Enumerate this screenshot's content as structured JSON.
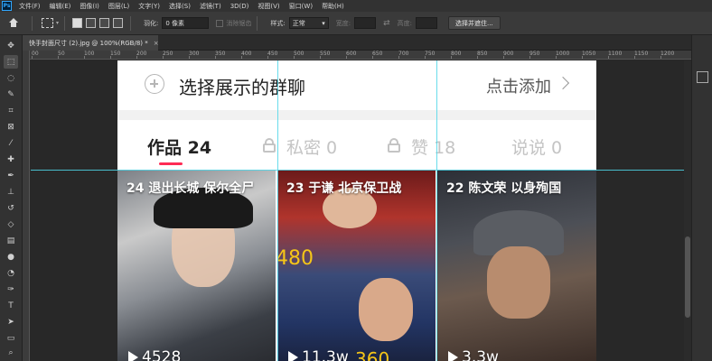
{
  "menubar": {
    "logo": "Ps",
    "items": [
      "文件(F)",
      "编辑(E)",
      "图像(I)",
      "图层(L)",
      "文字(Y)",
      "选择(S)",
      "滤镜(T)",
      "3D(D)",
      "视图(V)",
      "窗口(W)",
      "帮助(H)"
    ]
  },
  "options": {
    "feather_label": "羽化:",
    "feather_value": "0 像素",
    "antialias_label": "消除锯齿",
    "style_label": "样式:",
    "style_value": "正常",
    "width_label": "宽度:",
    "height_label": "高度:",
    "select_mask_button": "选择并遮住..."
  },
  "document": {
    "tab_title": "快手封面尺寸 (2).jpg @ 100%(RGB/8) *",
    "tab_close": "×"
  },
  "ruler": {
    "labels": [
      "00",
      "50",
      "100",
      "150",
      "200",
      "250",
      "300",
      "350",
      "400",
      "450",
      "500",
      "550",
      "600",
      "650",
      "700",
      "750",
      "800",
      "850",
      "900",
      "950",
      "1000",
      "1050",
      "1100",
      "1150",
      "1200"
    ]
  },
  "app": {
    "select_group": "选择展示的群聊",
    "click_add": "点击添加",
    "tabs": [
      {
        "label": "作品 24",
        "locked": false,
        "active": true
      },
      {
        "label": "私密 0",
        "locked": true,
        "active": false
      },
      {
        "label": "赞 18",
        "locked": true,
        "active": false
      },
      {
        "label": "说说 0",
        "locked": false,
        "active": false
      }
    ],
    "videos": [
      {
        "title": "24 退出长城 保尔全尸",
        "plays": "4528"
      },
      {
        "title": "23 于谦 北京保卫战",
        "plays": "11.3w",
        "overlay_left": "480",
        "overlay_bottom": "360"
      },
      {
        "title": "22 陈文荣 以身殉国",
        "plays": "3.3w"
      }
    ]
  },
  "colors": {
    "accent_underline": "#fe2c55",
    "guide": "#4fd7e9",
    "overlay_number": "#f5c518"
  }
}
